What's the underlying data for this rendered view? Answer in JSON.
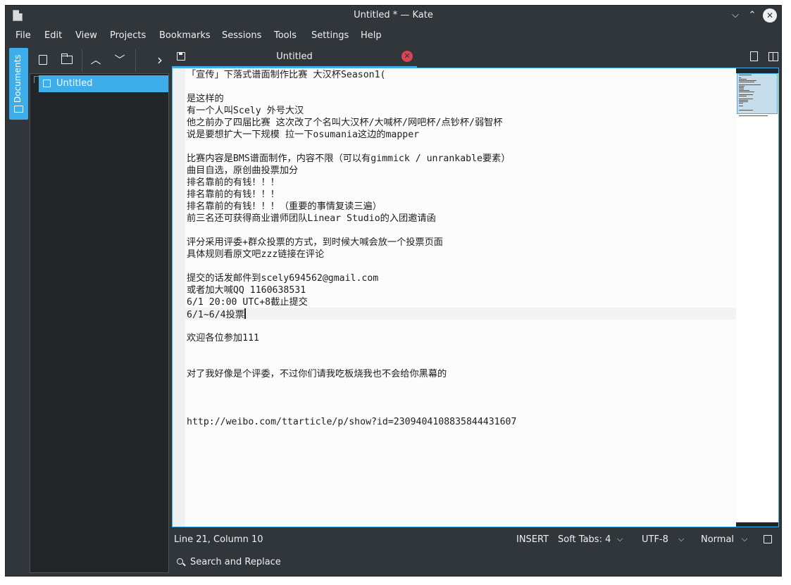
{
  "window": {
    "title": "Untitled * — Kate",
    "minimize_glyph": "⌵",
    "maximize_glyph": "⌃",
    "close_glyph": "✕"
  },
  "menu": [
    "File",
    "Edit",
    "View",
    "Projects",
    "Bookmarks",
    "Sessions",
    "Tools",
    "Settings",
    "Help"
  ],
  "sidebar": {
    "tab_label": "Documents"
  },
  "toolbar": {
    "prev_glyph": "︿",
    "next_glyph": "﹀",
    "more_glyph": "›"
  },
  "documents": {
    "items": [
      {
        "label": "Untitled"
      }
    ]
  },
  "tabs": [
    {
      "label": "Untitled",
      "close_glyph": "✕"
    }
  ],
  "editor": {
    "lines": [
      "「宣传」下落式谱面制作比赛 大汉杯Season1(",
      "",
      "是这样的",
      "有一个人叫Scely 外号大汉",
      "他之前办了四届比赛 这次改了个名叫大汉杯/大喊杯/网吧杯/点钞杯/弱智杯",
      "说是要想扩大一下规模 拉一下osumania这边的mapper",
      "",
      "比赛内容是BMS谱面制作，内容不限（可以有gimmick / unrankable要素）",
      "曲目自选，原创曲投票加分",
      "排名靠前的有钱！！！",
      "排名靠前的有钱！！！",
      "排名靠前的有钱！！！（重要的事情复读三遍）",
      "前三名还可获得商业谱师团队Linear Studio的入团邀请函",
      "",
      "评分采用评委+群众投票的方式，到时候大喊会放一个投票页面",
      "具体规则看原文吧zzz链接在评论",
      "",
      "提交的话发邮件到scely694562@gmail.com",
      "或者加大喊QQ 1160638531",
      "6/1 20:00 UTC+8截止提交",
      "6/1~6/4投票",
      "",
      "欢迎各位参加111",
      "",
      "",
      "对了我好像是个评委，不过你们请我吃板烧我也不会给你黑幕的",
      "",
      "",
      "",
      "http://weibo.com/ttarticle/p/show?id=2309404108835844431607"
    ]
  },
  "status": {
    "position": "Line 21, Column 10",
    "mode": "INSERT",
    "indent": "Soft Tabs: 4",
    "encoding": "UTF-8",
    "highlight": "Normal",
    "chevron": "⌵"
  },
  "search": {
    "label": "Search and Replace"
  }
}
